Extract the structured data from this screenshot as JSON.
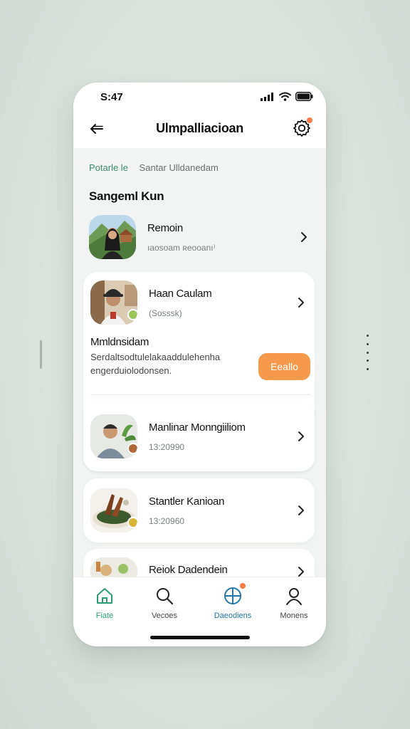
{
  "status": {
    "time": "S:47"
  },
  "header": {
    "title": "Ulmpalliacioan"
  },
  "breadcrumb": {
    "first": "Potarle le",
    "second": "Santar Ulldanedam"
  },
  "section": {
    "title": "Sangeml Kun"
  },
  "items": [
    {
      "name": "Remoin",
      "sub_left": "ıaosoam",
      "sub_right": "ʀeooanı⁾",
      "avatar": "landscape-person-photo"
    },
    {
      "name": "Haan Caulam",
      "sub": "(Sosssk)",
      "avatar": "man-portrait-photo"
    },
    {
      "name": "Manlinar Monngiiliom",
      "sub": "13:20990",
      "avatar": "man-plant-photo"
    },
    {
      "name": "Stantler Kanioan",
      "sub": "13:20960",
      "avatar": "food-dish-photo"
    },
    {
      "name": "Reiok Dadendein",
      "avatar": "ingredients-photo"
    }
  ],
  "detail": {
    "title": "Mmldnsidam",
    "text": "Serdaltsodtulelakaaddulehenha engerduiolodonsen.",
    "button_label": "Eeallo"
  },
  "nav": [
    {
      "label": "Fiate",
      "icon": "home-icon",
      "state": "active"
    },
    {
      "label": "Vecoes",
      "icon": "search-icon",
      "state": "inactive"
    },
    {
      "label": "Daeodiens",
      "icon": "explore-icon",
      "state": "highlight"
    },
    {
      "label": "Monens",
      "icon": "profile-icon",
      "state": "inactive"
    }
  ],
  "colors": {
    "accent_green": "#2f9e74",
    "accent_orange": "#f59a4b",
    "accent_blue": "#2776a8",
    "notification": "#ff7a45"
  }
}
